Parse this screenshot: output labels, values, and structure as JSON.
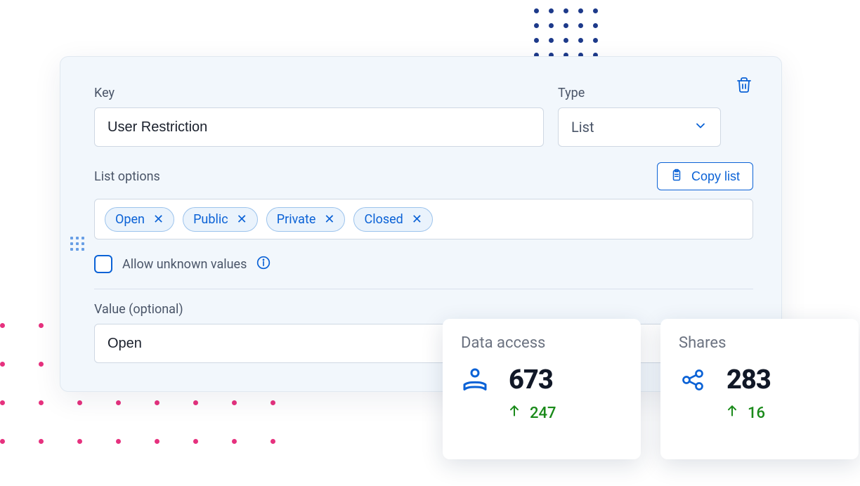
{
  "form": {
    "key_label": "Key",
    "key_value": "User Restriction",
    "type_label": "Type",
    "type_value": "List",
    "list_options_label": "List options",
    "copy_list_label": "Copy list",
    "chips": [
      "Open",
      "Public",
      "Private",
      "Closed"
    ],
    "allow_unknown_label": "Allow unknown values",
    "value_label": "Value (optional)",
    "value_value": "Open"
  },
  "stats": {
    "data_access": {
      "title": "Data access",
      "value": "673",
      "delta": "247"
    },
    "shares": {
      "title": "Shares",
      "value": "283",
      "delta": "16"
    }
  },
  "colors": {
    "accent": "#0b62d6",
    "positive": "#1a8a1a"
  }
}
